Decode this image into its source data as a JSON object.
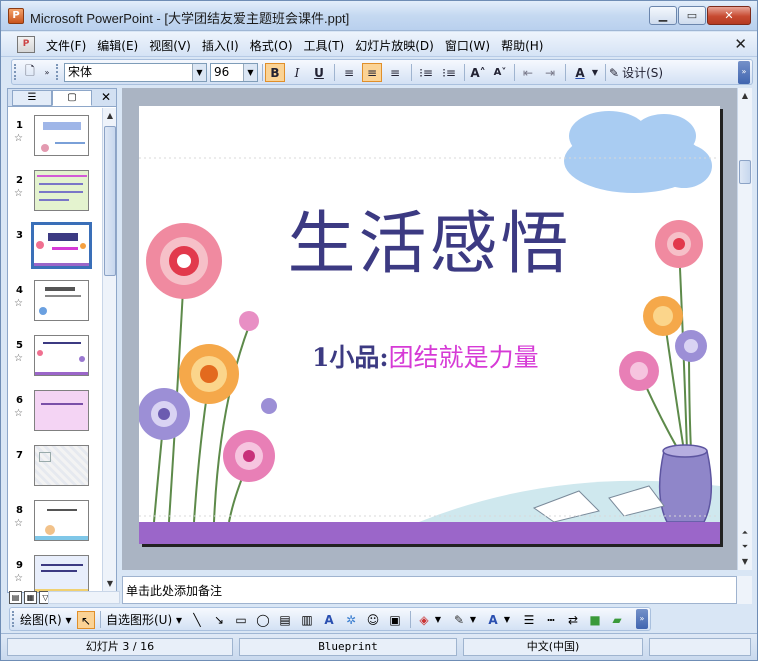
{
  "window": {
    "app_icon": "powerpoint-icon",
    "title": "Microsoft PowerPoint - [大学团结友爱主题班会课件.ppt]",
    "buttons": [
      "minimize",
      "maximize",
      "close"
    ]
  },
  "menubar": {
    "items": [
      "文件(F)",
      "编辑(E)",
      "视图(V)",
      "插入(I)",
      "格式(O)",
      "工具(T)",
      "幻灯片放映(D)",
      "窗口(W)",
      "帮助(H)"
    ],
    "close_symbol": "✕"
  },
  "toolbar": {
    "font_name": "宋体",
    "font_size": "96",
    "bold": "B",
    "italic": "I",
    "underline": "U",
    "design_label": "设计(S)"
  },
  "slides_panel": {
    "close_symbol": "✕",
    "thumbnails": [
      {
        "number": "1"
      },
      {
        "number": "2"
      },
      {
        "number": "3"
      },
      {
        "number": "4"
      },
      {
        "number": "5"
      },
      {
        "number": "6"
      },
      {
        "number": "7"
      },
      {
        "number": "8"
      },
      {
        "number": "9"
      }
    ],
    "selected": "3"
  },
  "slide": {
    "title": "生活感悟",
    "subtitle_prefix": "1小品:",
    "subtitle_highlight": "团结就是力量",
    "title_color": "#3c3a82",
    "highlight_color": "#d63ad6",
    "band_color": "#9b66c9"
  },
  "notes": {
    "placeholder": "单击此处添加备注"
  },
  "drawing_toolbar": {
    "draw_label": "绘图(R)",
    "autoshapes_label": "自选图形(U)"
  },
  "statusbar": {
    "slide_position": "幻灯片 3 / 16",
    "design_template": "Blueprint",
    "language": "中文(中国)"
  }
}
